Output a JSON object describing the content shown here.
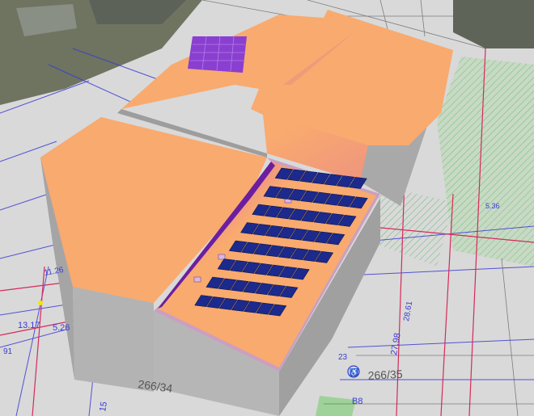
{
  "viewer": {
    "mode": "3d-solar-irradiance-view"
  },
  "colors": {
    "roof_high_irradiance": "#f9aa6f",
    "roof_shade": "#a03fb8",
    "wall": "#b8b8b8",
    "wall_dark": "#9d9d9d",
    "panel": "#1b2a8c",
    "plan_blue": "#3a3ad6",
    "plan_red": "#d62a5a",
    "plan_green": "#3fae4a",
    "ground": "#d6d6d6"
  },
  "plan_labels": {
    "parcel_left": "266/34",
    "parcel_right": "266/35",
    "dim_1": "13.17",
    "dim_2": "5.26",
    "dim_3": "11.26",
    "dim_4": "27.98",
    "dim_5": "28.61",
    "dim_6": "23",
    "dim_7": "15",
    "dim_8": "91",
    "dim_9": "5.36",
    "dim_10": "B8"
  },
  "pv_array": {
    "rows": 8,
    "modules_per_row": [
      7,
      8,
      8,
      8,
      8,
      7,
      7,
      7
    ]
  }
}
